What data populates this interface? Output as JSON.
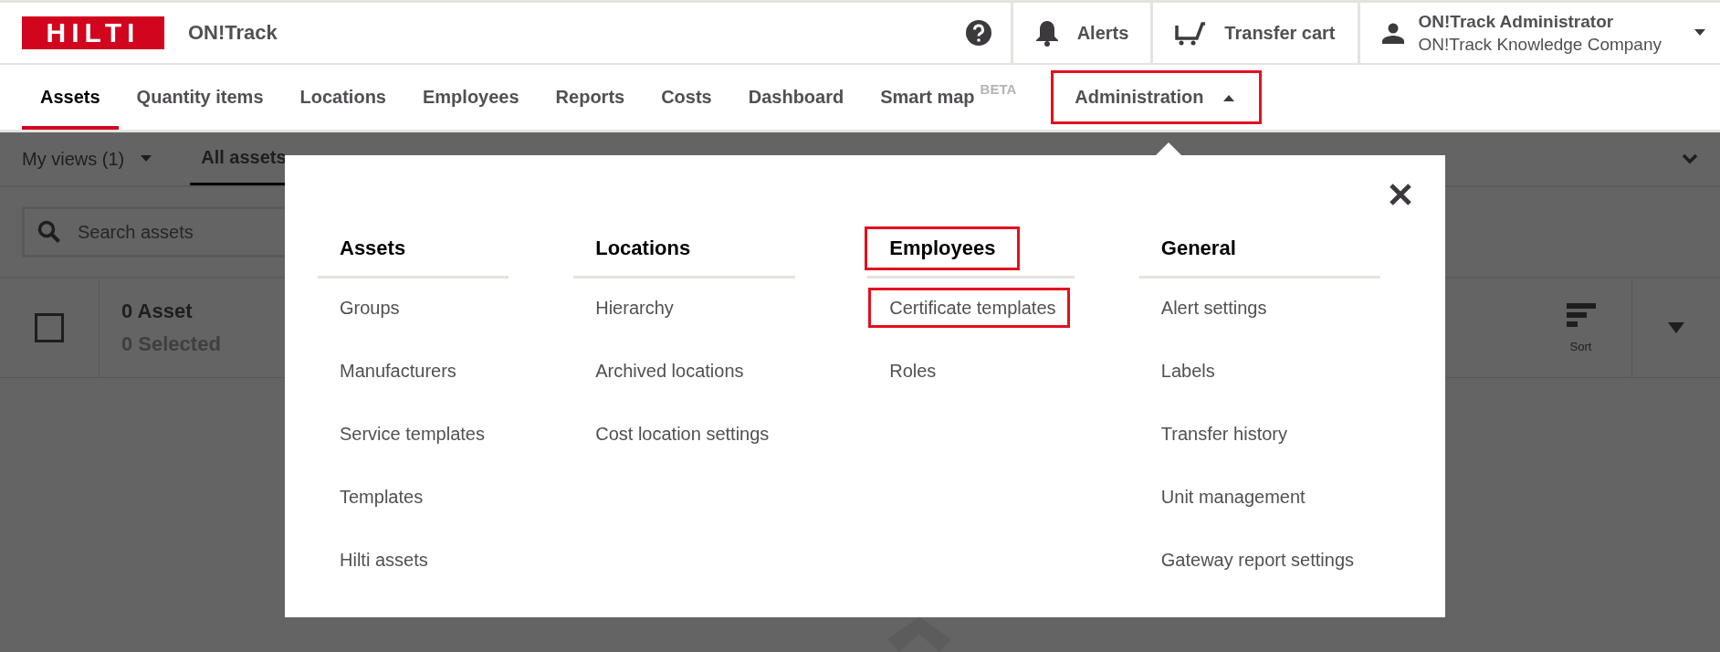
{
  "header": {
    "logo": "HILTI",
    "app_name": "ON!Track",
    "alerts": "Alerts",
    "transfer_cart": "Transfer cart",
    "user": {
      "name": "ON!Track Administrator",
      "company": "ON!Track Knowledge Company"
    }
  },
  "nav": [
    {
      "label": "Assets",
      "selected": true,
      "highlighted": false
    },
    {
      "label": "Quantity items",
      "selected": false,
      "highlighted": false
    },
    {
      "label": "Locations",
      "selected": false,
      "highlighted": false
    },
    {
      "label": "Employees",
      "selected": false,
      "highlighted": false
    },
    {
      "label": "Reports",
      "selected": false,
      "highlighted": false
    },
    {
      "label": "Costs",
      "selected": false,
      "highlighted": false
    },
    {
      "label": "Dashboard",
      "selected": false,
      "highlighted": false
    },
    {
      "label": "Smart map",
      "badge": "BETA",
      "selected": false,
      "highlighted": false
    },
    {
      "label": "Administration",
      "selected": false,
      "expanded": true,
      "highlighted": true,
      "kind": "dropdown"
    }
  ],
  "views": {
    "my_views": "My views (1)",
    "tabs": [
      {
        "label": "All assets",
        "selected": true
      }
    ]
  },
  "search": {
    "placeholder": "Search assets"
  },
  "list_header": {
    "checked": false,
    "count": "0 Asset",
    "selected_count": "0 Selected",
    "sort": "Sort"
  },
  "admin_menu": {
    "columns": [
      {
        "heading": "Assets",
        "highlighted": false,
        "items": [
          {
            "label": "Groups",
            "highlighted": false
          },
          {
            "label": "Manufacturers",
            "highlighted": false
          },
          {
            "label": "Service templates",
            "highlighted": false
          },
          {
            "label": "Templates",
            "highlighted": false
          },
          {
            "label": "Hilti assets",
            "highlighted": false
          }
        ]
      },
      {
        "heading": "Locations",
        "highlighted": false,
        "items": [
          {
            "label": "Hierarchy",
            "highlighted": false
          },
          {
            "label": "Archived locations",
            "highlighted": false
          },
          {
            "label": "Cost location settings",
            "highlighted": false
          }
        ]
      },
      {
        "heading": "Employees",
        "highlighted": true,
        "items": [
          {
            "label": "Certificate templates",
            "highlighted": true
          },
          {
            "label": "Roles",
            "highlighted": false
          }
        ]
      },
      {
        "heading": "General",
        "highlighted": false,
        "items": [
          {
            "label": "Alert settings",
            "highlighted": false
          },
          {
            "label": "Labels",
            "highlighted": false
          },
          {
            "label": "Transfer history",
            "highlighted": false
          },
          {
            "label": "Unit management",
            "highlighted": false
          },
          {
            "label": "Gateway report settings",
            "highlighted": false
          }
        ]
      }
    ]
  }
}
